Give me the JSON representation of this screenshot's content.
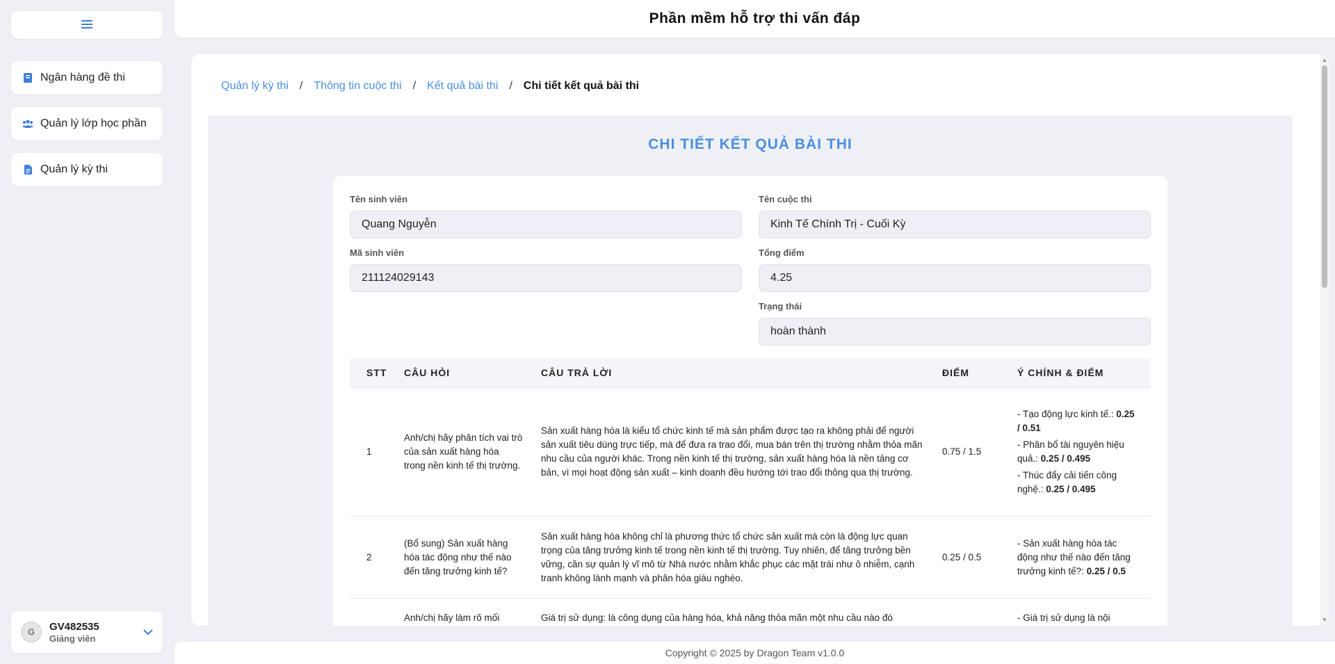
{
  "app_title": "Phần mềm hỗ trợ thi vấn đáp",
  "sidebar": {
    "menu_icon": "hamburger-icon",
    "items": [
      {
        "label": "Ngân hàng đề thi",
        "icon": "book-icon"
      },
      {
        "label": "Quản lý lớp học phần",
        "icon": "users-icon"
      },
      {
        "label": "Quản lý kỳ thi",
        "icon": "document-icon"
      }
    ],
    "user": {
      "avatar_letter": "G",
      "id": "GV482535",
      "role": "Giảng viên"
    }
  },
  "breadcrumb": {
    "items": [
      "Quản lý kỳ thi",
      "Thông tin cuộc thi",
      "Kết quả bài thi"
    ],
    "separator": "/",
    "current": "Chi tiết kết quả bài thi"
  },
  "page_title": "CHI TIẾT KẾT QUẢ BÀI THI",
  "fields": {
    "student_name": {
      "label": "Tên sinh viên",
      "value": "Quang Nguyễn"
    },
    "exam_name": {
      "label": "Tên cuộc thi",
      "value": "Kinh Tế Chính Trị - Cuối Kỳ"
    },
    "student_id": {
      "label": "Mã sinh viên",
      "value": "211124029143"
    },
    "total_score": {
      "label": "Tổng điểm",
      "value": "4.25"
    },
    "status": {
      "label": "Trạng thái",
      "value": "hoàn thành"
    }
  },
  "table": {
    "headers": [
      "STT",
      "CÂU HỎI",
      "CÂU TRẢ LỜI",
      "ĐIỂM",
      "Ý CHÍNH & ĐIỂM"
    ],
    "rows": [
      {
        "stt": "1",
        "question": "Anh/chị hãy phân tích vai trò của sản xuất hàng hóa trong nền kinh tế thị trường.",
        "answer": "Sản xuất hàng hóa là kiểu tổ chức kinh tế mà sản phẩm được tạo ra không phải để người sản xuất tiêu dùng trực tiếp, mà để đưa ra trao đổi, mua bán trên thị trường nhằm thỏa mãn nhu cầu của người khác. Trong nền kinh tế thị trường, sản xuất hàng hóa là nền tảng cơ bản, vì mọi hoạt động sản xuất – kinh doanh đều hướng tới trao đổi thông qua thị trường.",
        "score": "0.75 / 1.5",
        "key_points": [
          {
            "text": "- Tạo động lực kinh tế.:",
            "score": "0.25 / 0.51"
          },
          {
            "text": "- Phân bổ tài nguyên hiệu quả.:",
            "score": "0.25 / 0.495"
          },
          {
            "text": "- Thúc đẩy cải tiến công nghệ.:",
            "score": "0.25 / 0.495"
          }
        ]
      },
      {
        "stt": "2",
        "question": "(Bổ sung) Sản xuất hàng hóa tác động như thế nào đến tăng trưởng kinh tế?",
        "answer": "Sản xuất hàng hóa không chỉ là phương thức tổ chức sản xuất mà còn là động lực quan trọng của tăng trưởng kinh tế trong nền kinh tế thị trường. Tuy nhiên, để tăng trưởng bền vững, cần sự quản lý vĩ mô từ Nhà nước nhằm khắc phục các mặt trái như ô nhiễm, cạnh tranh không lành mạnh và phân hóa giàu nghèo.",
        "score": "0.25 / 0.5",
        "key_points": [
          {
            "text": "- Sản xuất hàng hóa tác động như thế nào đến tăng trưởng kinh tế?:",
            "score": "0.25 / 0.5"
          }
        ]
      },
      {
        "stt": "",
        "question": "Anh/chị hãy làm rõ mối",
        "answer": "Giá trị sử dụng: là công dụng của hàng hóa, khả năng thỏa mãn một nhu cầu nào đó",
        "score": "",
        "key_points": [
          {
            "text": "- Giá trị sử dụng là nội",
            "score": ""
          }
        ]
      }
    ]
  },
  "footer": "Copyright © 2025 by Dragon Team v1.0.0",
  "colors": {
    "accent": "#4a8edd",
    "background": "#eef0f6"
  }
}
